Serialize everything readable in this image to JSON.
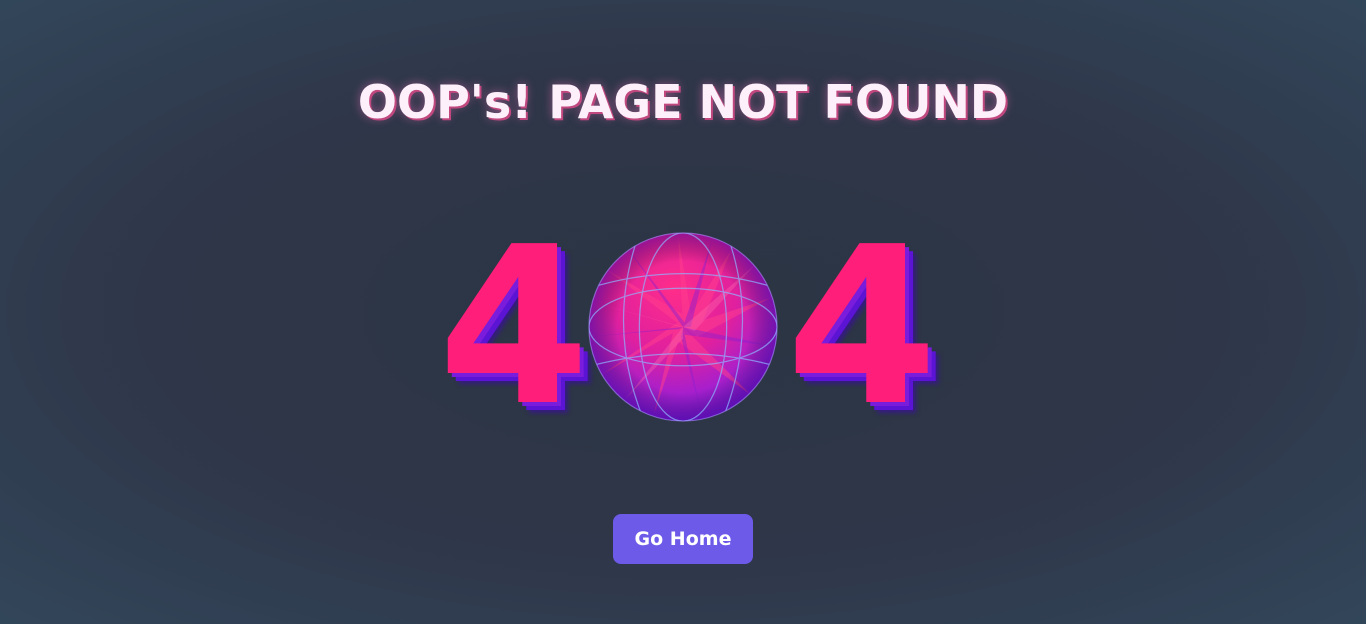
{
  "page": {
    "title": "OOP's! PAGE NOT FOUND"
  },
  "error": {
    "digit_left": "4",
    "digit_right": "4"
  },
  "actions": {
    "home_label": "Go Home"
  },
  "icons": {
    "globe": "globe-icon"
  },
  "colors": {
    "digit": "#ff1e79",
    "digit_shadow": "#5b14d4",
    "title": "#fdf0fa",
    "button": "#6d5ae8",
    "background": "#2f3649"
  }
}
